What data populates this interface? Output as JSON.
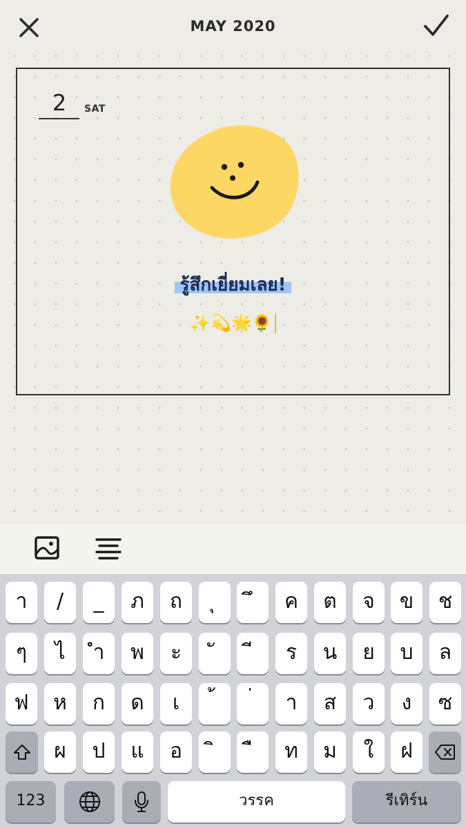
{
  "header": {
    "title": "MAY 2020",
    "close_icon": "close-icon",
    "confirm_icon": "checkmark-icon"
  },
  "entry": {
    "day_number": "2",
    "day_name": "SAT",
    "mood_sticker": "yellow-smiley-sticker",
    "mood_text": "รู้สึกเยี่ยมเลย!",
    "emojis": "✨💫🌟🌻"
  },
  "toolbar": {
    "image_icon": "image-icon",
    "align_icon": "align-center-icon"
  },
  "keyboard": {
    "row1": [
      "า",
      "/",
      "_",
      "ภ",
      "ถ",
      "ุ",
      "ึ",
      "ค",
      "ต",
      "จ",
      "ข",
      "ช"
    ],
    "row2": [
      "ๆ",
      "ไ",
      "ำ",
      "พ",
      "ะ",
      "ั",
      "ี",
      "ร",
      "น",
      "ย",
      "บ",
      "ล"
    ],
    "row3": [
      "ฟ",
      "ห",
      "ก",
      "ด",
      "เ",
      "้",
      "่",
      "า",
      "ส",
      "ว",
      "ง",
      "ซ"
    ],
    "row4": [
      "ผ",
      "ป",
      "แ",
      "อ",
      "ิ",
      "ื",
      "ท",
      "ม",
      "ใ",
      "ฝ"
    ],
    "numbers_label": "123",
    "space_label": "วรรค",
    "return_label": "รีเทิร์น",
    "shift_icon": "shift-icon",
    "delete_icon": "delete-icon",
    "globe_icon": "globe-icon",
    "mic_icon": "microphone-icon"
  },
  "colors": {
    "background": "#edece6",
    "sticker_yellow": "#fdd764",
    "highlight_blue": "#9cc6f3",
    "keyboard_bg": "#d1d3d9"
  }
}
